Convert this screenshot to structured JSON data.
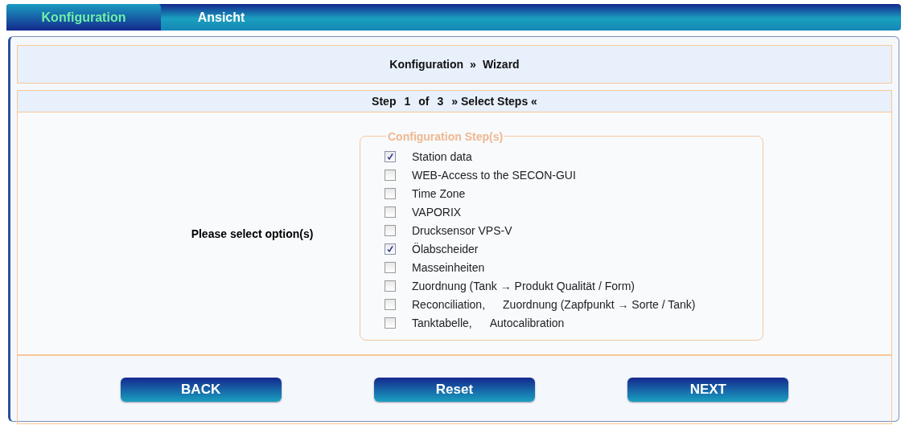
{
  "tabs": [
    {
      "label": "Konfiguration",
      "selected": true
    },
    {
      "label": "Ansicht",
      "selected": false
    }
  ],
  "breadcrumb": [
    "Konfiguration",
    "»",
    "Wizard"
  ],
  "step": [
    "Step",
    "1",
    "of",
    "3",
    "» Select Steps «"
  ],
  "prompt": "Please select option(s)",
  "fieldset": {
    "legend": "Configuration Step(s)",
    "options": [
      {
        "parts": [
          "Station data"
        ],
        "checked": true
      },
      {
        "parts": [
          "WEB-Access to the SECON-GUI"
        ],
        "checked": false
      },
      {
        "parts": [
          "Time Zone"
        ],
        "checked": false
      },
      {
        "parts": [
          "VAPORIX"
        ],
        "checked": false
      },
      {
        "parts": [
          "Drucksensor VPS-V"
        ],
        "checked": false
      },
      {
        "parts": [
          "Ölabscheider"
        ],
        "checked": true
      },
      {
        "parts": [
          "Masseinheiten"
        ],
        "checked": false
      },
      {
        "parts": [
          "Zuordnung (Tank → Produkt Qualität / Form)"
        ],
        "checked": false
      },
      {
        "parts": [
          "Reconciliation,",
          "Zuordnung (Zapfpunkt → Sorte / Tank)"
        ],
        "checked": false
      },
      {
        "parts": [
          "Tanktabelle,",
          "Autocalibration"
        ],
        "checked": false
      }
    ]
  },
  "buttons": [
    "BACK",
    "Reset",
    "NEXT"
  ]
}
